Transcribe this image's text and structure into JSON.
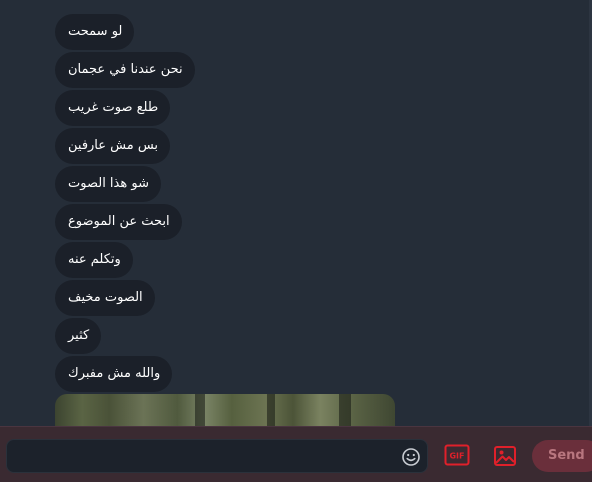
{
  "messages": [
    "لو سمحت",
    "نحن عندنا في عجمان",
    "طلع صوت غريب",
    "بس مش عارفين",
    "شو هذا الصوت",
    "ابحث عن الموضوع",
    "وتكلم عنه",
    "الصوت مخيف",
    "كثير",
    "والله مش مفبرك"
  ],
  "composer": {
    "placeholder": "",
    "emoji_icon": "emoji-smile-icon",
    "gif_icon": "gif-icon",
    "gif_label": "GIF",
    "image_icon": "image-icon",
    "send_label": "Send"
  },
  "colors": {
    "background": "#252d38",
    "bubble": "#1b2029",
    "accent": "#e0202a",
    "send_bg": "#6a2f3b"
  }
}
